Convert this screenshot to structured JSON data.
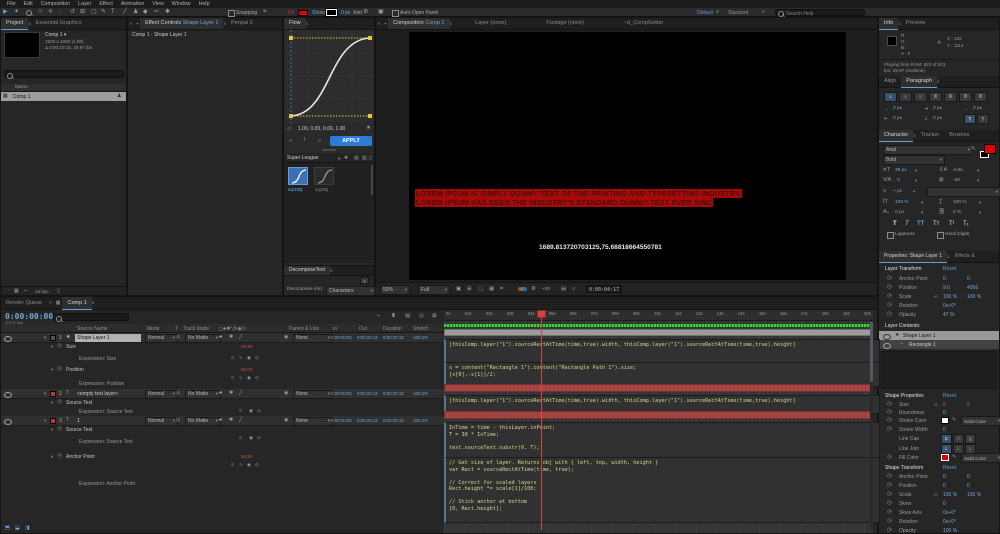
{
  "menu": {
    "items": [
      "File",
      "Edit",
      "Composition",
      "Layer",
      "Effect",
      "Animation",
      "View",
      "Window",
      "Help"
    ]
  },
  "toolbar": {
    "snapping": "Snapping",
    "fill_label": "Fill",
    "stroke_label": "Stroke",
    "stroke_value": "0 px",
    "add_label": "Add",
    "auto_open": "Auto-Open Panel",
    "workspace_active": "Default",
    "workspace_other": "Standard",
    "search_placeholder": "Search Help"
  },
  "project": {
    "tab": "Project",
    "tab_eg": "Essential Graphics",
    "comp_name": "Comp 1",
    "info_line1": "1920 x 1080 (1.00)",
    "info_line2": "Δ 0:00:20:15, 29.97 fps",
    "name_header": "Name",
    "row_label": "Comp 1",
    "bpc": "16 bpc"
  },
  "effect_controls": {
    "tab_label": "Effect Controls",
    "tab_layer": "Shape Layer 1",
    "tab_other": "Penpal 2",
    "context": "Comp 1 · Shape Layer 1"
  },
  "flow": {
    "tab": "Flow",
    "values_label": "1.00, 0.00, 0.00, 1.00",
    "apply_label": "APPLY",
    "library_name": "Super League",
    "preset_selected": "sqr100j",
    "preset_other": "sq100j"
  },
  "decompose": {
    "tab": "DecomposeText",
    "button_label": "1",
    "into_label": "Decompose into:",
    "into_value": "Characters"
  },
  "viewer": {
    "tab_label": "Composition",
    "tab_comp": "Comp 1",
    "tab_layer": "Layer (none)",
    "tab_footage": "Footage (none)",
    "tab_script": "~d_CompGetter",
    "lorem_line1": "LOREM IPSUM IS SIMPLY DUMMY TEXT OF THE PRINTING AND TYPESETTING INDUSTRY,",
    "lorem_line2": "LOREM IPSUM HAS BEEN THE INDUSTRY'S STANDARD DUMMY TEXT EVER SINC",
    "coords": "1689.813720703125,75.68818664550781",
    "zoom_value": "50%",
    "resolution": "Full",
    "exposure": "+00",
    "timecode": "0:00:04:17"
  },
  "info": {
    "tab": "Info",
    "tab_preview": "Preview",
    "r_label": "R :",
    "g_label": "G :",
    "b_label": "B :",
    "a_label": "A :",
    "a_value": "0",
    "x_label": "X :",
    "x_value": "102",
    "y_label": "Y :",
    "y_value": "1114",
    "status_line1": "Playing from RAM: 623 of 623",
    "status_line2": "fps: 29.97 (realtime)"
  },
  "paragraph": {
    "tab_align": "Align",
    "tab": "Paragraph",
    "fields": [
      "0 px",
      "0 px",
      "0 px",
      "0 px",
      "0 px",
      "0 px"
    ]
  },
  "character": {
    "tab": "Character",
    "tab_tracker": "Tracker",
    "tab_brushes": "Brushes",
    "font_family": "Arial",
    "font_style": "Bold",
    "font_size": "39 px",
    "leading": "Auto",
    "kerning": "0",
    "tracking": "-50",
    "stroke_width": "~ px",
    "vertical_scale": "100 %",
    "horizontal_scale": "100 %",
    "baseline_shift": "0 px",
    "tsume": "0 %",
    "ligatures_label": "Ligatures",
    "hindi_label": "Hindi Digits"
  },
  "properties": {
    "tab": "Properties: Shape Layer 1",
    "tab_effects": "Effects &",
    "reset_label": "Reset",
    "layer_transform_title": "Layer Transform",
    "lt": {
      "anchor_label": "Anchor Point",
      "anchor_x": "0",
      "anchor_y": "0",
      "position_label": "Position",
      "position_x": "9.6",
      "position_y": "4956",
      "scale_label": "Scale",
      "scale_x": "100 %",
      "scale_y": "100 %",
      "rotation_label": "Rotation",
      "rotation": "0x+0°",
      "opacity_label": "Opacity",
      "opacity": "47 %"
    },
    "layer_contents_title": "Layer Contents:",
    "content_item1": "Shape Layer 1",
    "content_item2": "Rectangle 1",
    "shape_properties_title": "Shape Properties",
    "sp": {
      "size_label": "Size",
      "size_x": "0",
      "size_y": "5",
      "roundness_label": "Roundness",
      "roundness": "0",
      "stroke_color_label": "Stroke Color",
      "stroke_type": "Solid Color",
      "stroke_width_label": "Stroke Width",
      "stroke_width": "0",
      "line_cap_label": "Line Cap",
      "line_join_label": "Line Join",
      "fill_color_label": "Fill Color",
      "fill_type": "Solid Color"
    },
    "shape_transform_title": "Shape Transform",
    "st": {
      "anchor_label": "Anchor Point",
      "anchor_x": "0",
      "anchor_y": "0",
      "position_label": "Position",
      "position_x": "0",
      "position_y": "0",
      "scale_label": "Scale",
      "scale_x": "100 %",
      "scale_y": "100 %",
      "skew_label": "Skew",
      "skew": "0",
      "skew_axis_label": "Skew Axis",
      "skew_axis": "0x+0°",
      "rotation_label": "Rotation",
      "rotation": "0x+0°",
      "opacity_label": "Opacity",
      "opacity": "100 %"
    }
  },
  "timeline": {
    "tab_render_queue": "Render Queue",
    "tab_comp": "Comp 1",
    "timecode": "0:00:00:00",
    "timecode_sub": "(29.97 fps)",
    "headers": {
      "source_name": "Source Name",
      "mode": "Mode",
      "t": "T",
      "track_matte": "Track Matte",
      "parent": "Parent & Link",
      "in": "In",
      "out": "Out",
      "duration": "Duration",
      "stretch": "Stretch"
    },
    "layers": [
      {
        "index": "1",
        "name": "Shape Layer 1",
        "mode": "Normal",
        "matte": "No Matte",
        "parent": "None",
        "in": "0:00:00:00",
        "out": "0:00:20:12",
        "duration": "0:00:20:13",
        "stretch": "100.0%"
      },
      {
        "index": "2",
        "name": "<empty text layer>",
        "mode": "Normal",
        "matte": "No Matte",
        "parent": "None",
        "in": "0:00:00:00",
        "out": "0:00:20:12",
        "duration": "0:00:20:13",
        "stretch": "100.0%"
      },
      {
        "index": "3",
        "name": "1",
        "mode": "Normal",
        "matte": "No Matte",
        "parent": "None",
        "in": "0:00:00:00",
        "out": "0:00:20:12",
        "duration": "0:00:20:13",
        "stretch": "100.0%"
      }
    ],
    "props": {
      "size_label": "Size",
      "size_value": "50,50",
      "expr_size": "Expression: Size",
      "position_label": "Position",
      "position_value": "50,00",
      "expr_position": "Expression: Position",
      "source_text_label": "Source Text",
      "expr_source_text": "Expression: Source Text",
      "anchor_label": "Anchor Point",
      "anchor_value": "50,50",
      "expr_anchor": "Expression: Anchor Point"
    },
    "ruler": [
      "0s",
      "01s",
      "02s",
      "03s",
      "04s",
      "05s",
      "06s",
      "07s",
      "08s",
      "09s",
      "10s",
      "11s",
      "12s",
      "13s",
      "14s",
      "15s",
      "16s",
      "17s",
      "18s",
      "19s",
      "20s"
    ],
    "expr": {
      "size": "[thisComp.layer(\"1\").sourceRectAtTime(time,true).width, thisComp.layer(\"1\").sourceRectAtTime(time,true).height]",
      "position_1": "s = content(\"Rectangle 1\").content(\"Rectangle Path 1\").size;",
      "position_2": "[s[0],-s[1]]/2;",
      "source_text2": "[thisComp.layer(\"1\").sourceRectAtTime(time,true).width, thisComp.layer(\"1\").sourceRectAtTime(time,true).height]",
      "source_text3_1": "InTime = time - thisLayer.inPoint;",
      "source_text3_2": "T = 30 * InTime;",
      "source_text3_3": "text.sourceText.substr(0, T);",
      "anchor_1": "// Get size of layer. Returns obj with { left, top, width, height }",
      "anchor_2": "var Rect = sourceRectAtTime(time, true);",
      "anchor_3": "// Correct for scaled layers",
      "anchor_4": "Rect.height *= scale[1]/100;",
      "anchor_5": "// Stick anchor at bottom",
      "anchor_6": "[0, Rect.height];"
    }
  }
}
